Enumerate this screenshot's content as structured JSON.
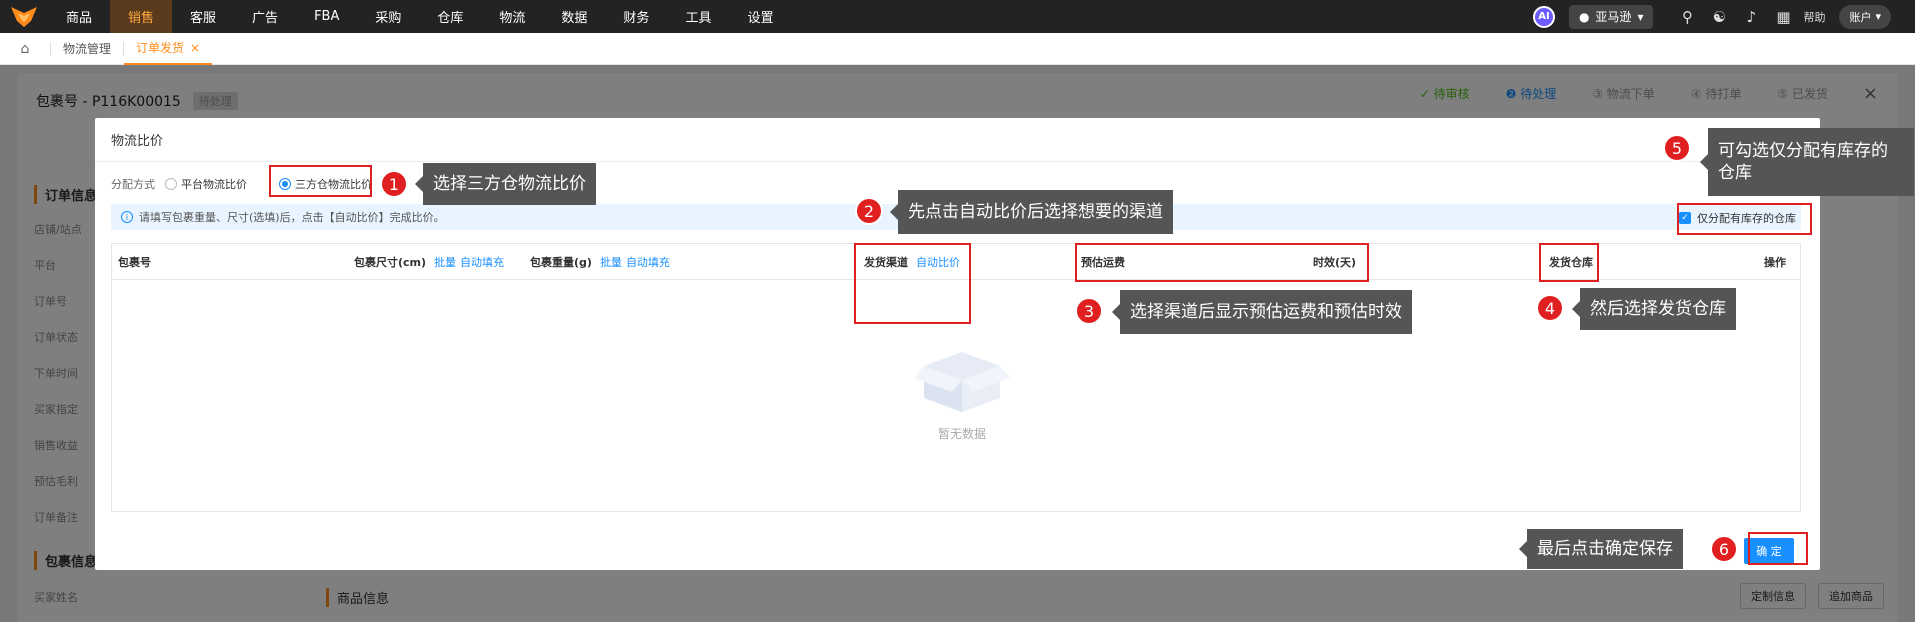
{
  "topnav": {
    "items": [
      "商品",
      "销售",
      "客服",
      "广告",
      "FBA",
      "采购",
      "仓库",
      "物流",
      "数据",
      "财务",
      "工具",
      "设置"
    ],
    "active_index": 1,
    "ai_label": "AI",
    "store": "亚马逊",
    "help": "帮助",
    "account": "账户"
  },
  "tabs": {
    "items": [
      "物流管理",
      "订单发货"
    ],
    "active_index": 1
  },
  "background": {
    "package_title": "包裹号 - P116K00015",
    "package_status": "待处理",
    "steps": [
      "待审核",
      "待处理",
      "物流下单",
      "待打单",
      "已发货"
    ],
    "left_sections": [
      "订单信息",
      "包裹信息"
    ],
    "left_rows": [
      "店铺/站点",
      "平台",
      "订单号",
      "订单状态",
      "下单时间",
      "买家指定",
      "销售收益",
      "预估毛利",
      "订单备注"
    ],
    "left_rows2": [
      "买家姓名"
    ],
    "goods_title": "商品信息",
    "btn_custom": "定制信息",
    "btn_add": "追加商品"
  },
  "modal": {
    "title": "物流比价",
    "alloc_label": "分配方式",
    "option_platform": "平台物流比价",
    "option_third": "三方仓物流比价",
    "info_text": "请填写包裹重量、尺寸(选填)后，点击【自动比价】完成比价。",
    "only_stock_label": "仅分配有库存的仓库",
    "table": {
      "col_pkg": "包裹号",
      "col_size": "包裹尺寸(cm)",
      "col_weight": "包裹重量(g)",
      "bulk": "批量",
      "autofill": "自动填充",
      "col_channel": "发货渠道",
      "auto_compare": "自动比价",
      "col_fee": "预估运费",
      "col_time": "时效(天)",
      "col_warehouse": "发货仓库",
      "col_op": "操作",
      "empty_text": "暂无数据"
    },
    "confirm_label": "确 定"
  },
  "annotations": [
    {
      "num": "1",
      "text": "选择三方仓物流比价"
    },
    {
      "num": "2",
      "text": "先点击自动比价后选择想要的渠道"
    },
    {
      "num": "3",
      "text": "选择渠道后显示预估运费和预估时效"
    },
    {
      "num": "4",
      "text": "然后选择发货仓库"
    },
    {
      "num": "5",
      "text": "可勾选仅分配有库存的仓库"
    },
    {
      "num": "6",
      "text": "最后点击确定保存"
    }
  ],
  "colors": {
    "accent": "#ff8c1a",
    "primary": "#1890ff",
    "annotation_red": "#e02020",
    "nav_bg": "#232323"
  }
}
